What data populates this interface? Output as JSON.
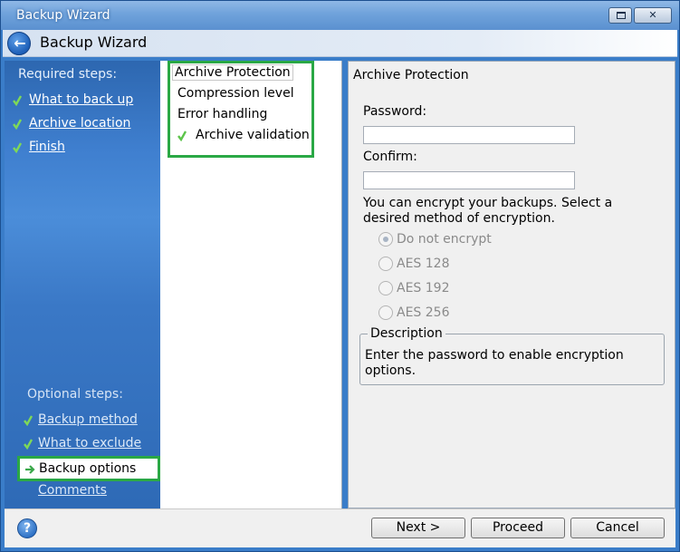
{
  "window": {
    "title": "Backup Wizard",
    "header_title": "Backup Wizard"
  },
  "leftnav": {
    "required_heading": "Required steps:",
    "required_items": [
      {
        "label": "What to back up",
        "done": true
      },
      {
        "label": "Archive location",
        "done": true
      },
      {
        "label": "Finish",
        "done": true
      }
    ],
    "optional_heading": "Optional steps:",
    "optional_items": [
      {
        "label": "Backup method",
        "done": true
      },
      {
        "label": "What to exclude",
        "done": true
      },
      {
        "label": "Backup options",
        "selected": true
      },
      {
        "label": "Comments",
        "done": false
      }
    ]
  },
  "options_list": [
    {
      "label": "Archive Protection",
      "selected": true
    },
    {
      "label": "Compression level"
    },
    {
      "label": "Error handling"
    },
    {
      "label": "Archive validation",
      "checked": true
    }
  ],
  "panel": {
    "title": "Archive Protection",
    "password_label": "Password:",
    "password_value": "",
    "confirm_label": "Confirm:",
    "confirm_value": "",
    "info": "You can encrypt your backups. Select a desired method of encryption.",
    "encryption_options": [
      {
        "label": "Do not encrypt",
        "checked": true
      },
      {
        "label": "AES 128"
      },
      {
        "label": "AES 192"
      },
      {
        "label": "AES 256"
      }
    ],
    "description_legend": "Description",
    "description_text": "Enter the password to enable encryption options."
  },
  "footer": {
    "next_label": "Next >",
    "proceed_label": "Proceed",
    "cancel_label": "Cancel"
  },
  "colors": {
    "highlight_green": "#2aa845",
    "nav_blue": "#3f7fcf"
  }
}
